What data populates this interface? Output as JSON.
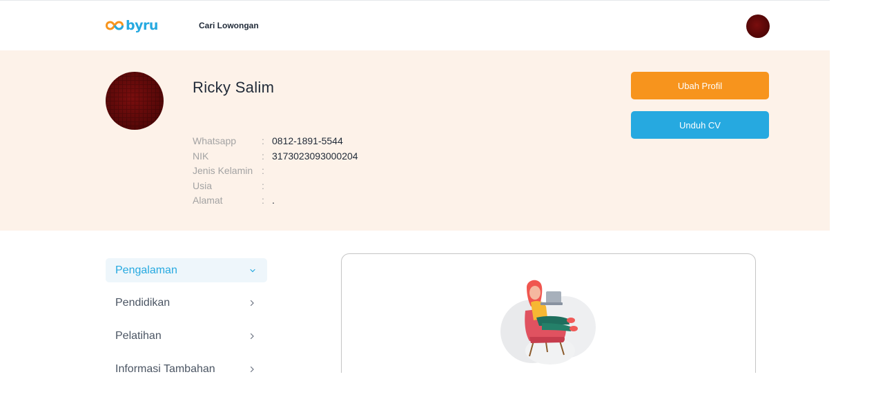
{
  "header": {
    "logo_text": "byru",
    "nav_link": "Cari Lowongan"
  },
  "colors": {
    "brand_blue": "#26a9e0",
    "brand_orange": "#f7941d",
    "banner_bg": "#fdf2e9"
  },
  "profile": {
    "name": "Ricky Salim",
    "fields": [
      {
        "label": "Whatsapp",
        "value": "0812-1891-5544"
      },
      {
        "label": "NIK",
        "value": "3173023093000204"
      },
      {
        "label": "Jenis Kelamin",
        "value": ""
      },
      {
        "label": "Usia",
        "value": ""
      },
      {
        "label": "Alamat",
        "value": "."
      }
    ],
    "colon": ":"
  },
  "actions": {
    "edit_profile": "Ubah Profil",
    "download_cv": "Unduh CV"
  },
  "menu": {
    "items": [
      {
        "label": "Pengalaman",
        "icon": "chevron-down-icon",
        "active": true
      },
      {
        "label": "Pendidikan",
        "icon": "chevron-right-icon",
        "active": false
      },
      {
        "label": "Pelatihan",
        "icon": "chevron-right-icon",
        "active": false
      },
      {
        "label": "Informasi Tambahan",
        "icon": "chevron-right-icon",
        "active": false
      }
    ]
  }
}
